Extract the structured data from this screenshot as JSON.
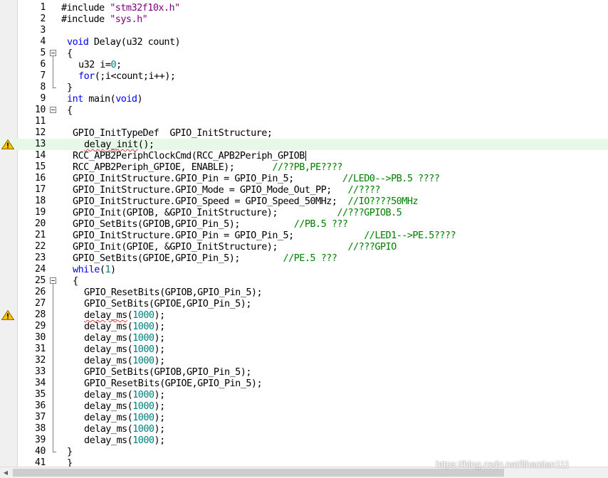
{
  "editor": {
    "colors": {
      "keyword": "#0000ff",
      "string": "#800080",
      "number": "#008080",
      "comment": "#008000",
      "text": "#000000",
      "current_line": "#e8f8e8"
    },
    "current_line": 13,
    "cursor_line": 14,
    "lines": [
      {
        "n": "1",
        "indent": 0,
        "tokens": [
          [
            "p",
            "#include "
          ],
          [
            "s",
            "\"stm32f10x.h\""
          ]
        ]
      },
      {
        "n": "2",
        "indent": 0,
        "tokens": [
          [
            "p",
            "#include "
          ],
          [
            "s",
            "\"sys.h\""
          ]
        ]
      },
      {
        "n": "3",
        "indent": 0,
        "tokens": []
      },
      {
        "n": "4",
        "indent": 1,
        "tokens": [
          [
            "k",
            "void"
          ],
          [
            "t",
            " Delay(u32 count)"
          ]
        ]
      },
      {
        "n": "5",
        "indent": 1,
        "fold": "open",
        "tokens": [
          [
            "t",
            "{"
          ]
        ]
      },
      {
        "n": "6",
        "indent": 3,
        "tokens": [
          [
            "t",
            "u32 i="
          ],
          [
            "n",
            "0"
          ],
          [
            "t",
            ";"
          ]
        ]
      },
      {
        "n": "7",
        "indent": 3,
        "tokens": [
          [
            "k",
            "for"
          ],
          [
            "t",
            "(;i<count;i++);"
          ]
        ]
      },
      {
        "n": "8",
        "indent": 1,
        "fold": "end",
        "tokens": [
          [
            "t",
            "}"
          ]
        ]
      },
      {
        "n": "9",
        "indent": 1,
        "tokens": [
          [
            "k",
            "int"
          ],
          [
            "t",
            " main("
          ],
          [
            "k",
            "void"
          ],
          [
            "t",
            ")"
          ]
        ]
      },
      {
        "n": "10",
        "indent": 1,
        "fold": "open",
        "tokens": [
          [
            "t",
            "{"
          ]
        ]
      },
      {
        "n": "11",
        "indent": 0,
        "tokens": []
      },
      {
        "n": "12",
        "indent": 2,
        "tokens": [
          [
            "t",
            "GPIO_InitTypeDef  GPIO_InitStructure;"
          ]
        ]
      },
      {
        "n": "13",
        "indent": 4,
        "warning": true,
        "tokens": [
          [
            "e",
            "delay_init"
          ],
          [
            "t",
            "();"
          ]
        ]
      },
      {
        "n": "14",
        "indent": 2,
        "tokens": [
          [
            "t",
            "RCC_APB2PeriphClockCmd(RCC_APB2Periph_GPIOB"
          ]
        ]
      },
      {
        "n": "15",
        "indent": 2,
        "tokens": [
          [
            "t",
            "RCC_APB2Periph_GPIOE, ENABLE);       "
          ],
          [
            "c",
            "//??PB,PE????"
          ]
        ]
      },
      {
        "n": "16",
        "indent": 2,
        "tokens": [
          [
            "t",
            "GPIO_InitStructure.GPIO_Pin = GPIO_Pin_5;         "
          ],
          [
            "c",
            "//LED0-->PB.5 ????"
          ]
        ]
      },
      {
        "n": "17",
        "indent": 2,
        "tokens": [
          [
            "t",
            "GPIO_InitStructure.GPIO_Mode = GPIO_Mode_Out_PP;   "
          ],
          [
            "c",
            "//????"
          ]
        ]
      },
      {
        "n": "18",
        "indent": 2,
        "tokens": [
          [
            "t",
            "GPIO_InitStructure.GPIO_Speed = GPIO_Speed_50MHz;  "
          ],
          [
            "c",
            "//IO????50MHz"
          ]
        ]
      },
      {
        "n": "19",
        "indent": 2,
        "tokens": [
          [
            "t",
            "GPIO_Init(GPIOB, &GPIO_InitStructure);           "
          ],
          [
            "c",
            "//???GPIOB.5"
          ]
        ]
      },
      {
        "n": "20",
        "indent": 2,
        "tokens": [
          [
            "t",
            "GPIO_SetBits(GPIOB,GPIO_Pin_5);          "
          ],
          [
            "c",
            "//PB.5 ???"
          ]
        ]
      },
      {
        "n": "21",
        "indent": 2,
        "tokens": [
          [
            "t",
            "GPIO_InitStructure.GPIO_Pin = GPIO_Pin_5;             "
          ],
          [
            "c",
            "//LED1-->PE.5????"
          ]
        ]
      },
      {
        "n": "22",
        "indent": 2,
        "tokens": [
          [
            "t",
            "GPIO_Init(GPIOE, &GPIO_InitStructure);             "
          ],
          [
            "c",
            "//???GPIO"
          ]
        ]
      },
      {
        "n": "23",
        "indent": 2,
        "tokens": [
          [
            "t",
            "GPIO_SetBits(GPIOE,GPIO_Pin_5);        "
          ],
          [
            "c",
            "//PE.5 ???"
          ]
        ]
      },
      {
        "n": "24",
        "indent": 2,
        "tokens": [
          [
            "k",
            "while"
          ],
          [
            "t",
            "("
          ],
          [
            "n",
            "1"
          ],
          [
            "t",
            ")"
          ]
        ]
      },
      {
        "n": "25",
        "indent": 2,
        "fold": "open",
        "tokens": [
          [
            "t",
            "{"
          ]
        ]
      },
      {
        "n": "26",
        "indent": 4,
        "tokens": [
          [
            "t",
            "GPIO_ResetBits(GPIOB,GPIO_Pin_5);"
          ]
        ]
      },
      {
        "n": "27",
        "indent": 4,
        "tokens": [
          [
            "t",
            "GPIO_SetBits(GPIOE,GPIO_Pin_5);"
          ]
        ]
      },
      {
        "n": "28",
        "indent": 4,
        "warning": true,
        "tokens": [
          [
            "e",
            "delay_ms"
          ],
          [
            "t",
            "("
          ],
          [
            "n",
            "1000"
          ],
          [
            "t",
            ");"
          ]
        ]
      },
      {
        "n": "29",
        "indent": 4,
        "tokens": [
          [
            "t",
            "delay_ms("
          ],
          [
            "n",
            "1000"
          ],
          [
            "t",
            ");"
          ]
        ]
      },
      {
        "n": "30",
        "indent": 4,
        "tokens": [
          [
            "t",
            "delay_ms("
          ],
          [
            "n",
            "1000"
          ],
          [
            "t",
            ");"
          ]
        ]
      },
      {
        "n": "31",
        "indent": 4,
        "tokens": [
          [
            "t",
            "delay_ms("
          ],
          [
            "n",
            "1000"
          ],
          [
            "t",
            ");"
          ]
        ]
      },
      {
        "n": "32",
        "indent": 4,
        "tokens": [
          [
            "t",
            "delay_ms("
          ],
          [
            "n",
            "1000"
          ],
          [
            "t",
            ");"
          ]
        ]
      },
      {
        "n": "33",
        "indent": 4,
        "tokens": [
          [
            "t",
            "GPIO_SetBits(GPIOB,GPIO_Pin_5);"
          ]
        ]
      },
      {
        "n": "34",
        "indent": 4,
        "tokens": [
          [
            "t",
            "GPIO_ResetBits(GPIOE,GPIO_Pin_5);"
          ]
        ]
      },
      {
        "n": "35",
        "indent": 4,
        "tokens": [
          [
            "t",
            "delay_ms("
          ],
          [
            "n",
            "1000"
          ],
          [
            "t",
            ");"
          ]
        ]
      },
      {
        "n": "36",
        "indent": 4,
        "tokens": [
          [
            "t",
            "delay_ms("
          ],
          [
            "n",
            "1000"
          ],
          [
            "t",
            ");"
          ]
        ]
      },
      {
        "n": "37",
        "indent": 4,
        "tokens": [
          [
            "t",
            "delay_ms("
          ],
          [
            "n",
            "1000"
          ],
          [
            "t",
            ");"
          ]
        ]
      },
      {
        "n": "38",
        "indent": 4,
        "tokens": [
          [
            "t",
            "delay_ms("
          ],
          [
            "n",
            "1000"
          ],
          [
            "t",
            ");"
          ]
        ]
      },
      {
        "n": "39",
        "indent": 4,
        "tokens": [
          [
            "t",
            "delay_ms("
          ],
          [
            "n",
            "1000"
          ],
          [
            "t",
            ");"
          ]
        ]
      },
      {
        "n": "40",
        "indent": 1,
        "fold": "end",
        "tokens": [
          [
            "t",
            "}"
          ]
        ]
      },
      {
        "n": "41",
        "indent": 1,
        "tokens": [
          [
            "t",
            "}"
          ]
        ]
      }
    ]
  },
  "watermark": "https://blog.csdn.net/lihaotian111"
}
